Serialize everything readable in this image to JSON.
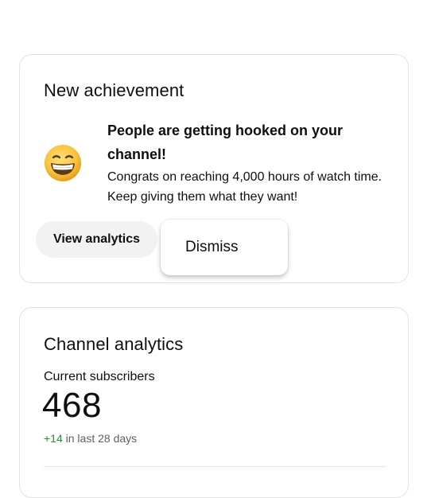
{
  "achievement": {
    "title": "New achievement",
    "emoji_icon": "grinning-face-icon",
    "headline": "People are getting hooked on your channel!",
    "body": "Congrats on reaching 4,000 hours of watch time. Keep giving them what they want!",
    "view_label": "View analytics",
    "menu": {
      "dismiss_label": "Dismiss"
    }
  },
  "analytics": {
    "title": "Channel analytics",
    "subscribers_label": "Current subscribers",
    "subscribers_count": "468",
    "change_delta": "+14",
    "change_period": "in last 28 days"
  },
  "colors": {
    "card_border": "#e2e2e2",
    "button_bg": "#f2f2f2",
    "positive_green": "#2b8a2b",
    "secondary_text": "#606060"
  }
}
